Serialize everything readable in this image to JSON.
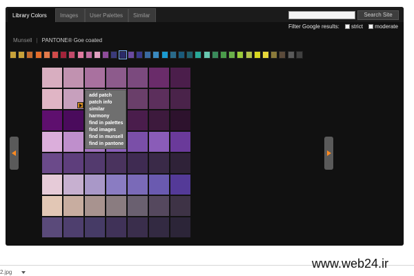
{
  "tabs": [
    {
      "label": "Library Colors",
      "active": true
    },
    {
      "label": "Images",
      "active": false
    },
    {
      "label": "User Palettes",
      "active": false
    },
    {
      "label": "Similar",
      "active": false
    }
  ],
  "search": {
    "placeholder": "",
    "button_label": "Search Site"
  },
  "filter": {
    "label": "Filter Google results:",
    "options": [
      {
        "label": "strict",
        "checked": false
      },
      {
        "label": "moderate",
        "checked": false
      }
    ]
  },
  "library": {
    "munsell": "Munsell",
    "separator": "|",
    "current": "PANTONE® Goe coated"
  },
  "hue_strip": {
    "selected_index": 13,
    "colors": [
      "#c8a23a",
      "#c8a23a",
      "#c46a2e",
      "#e36d2a",
      "#e27a4a",
      "#d04b4a",
      "#a3243a",
      "#c24a6a",
      "#e07aa0",
      "#c06ca0",
      "#e0a0c0",
      "#8e4c9a",
      "#3b3b7a",
      "#2b2b6a",
      "#6a4aa0",
      "#3a3a8a",
      "#3a6aa0",
      "#3a8ac0",
      "#1a9ad0",
      "#2a6a8a",
      "#1a5a7a",
      "#1f5f6a",
      "#28a898",
      "#68c8b0",
      "#3a8a5a",
      "#4a9a4a",
      "#6ab04a",
      "#9acb3a",
      "#b0c04a",
      "#d8d820",
      "#e8d83a",
      "#8a7a3a",
      "#5a4a3a",
      "#5a5a5a",
      "#404040"
    ]
  },
  "swatch_grid": {
    "rows": [
      [
        "#d8aec0",
        "#c192b0",
        "#a9719f",
        "#8d5b8c",
        "#7b4a7e",
        "#6a2c6a",
        "#4b1e4b"
      ],
      [
        "#e0b5c5",
        "#c7a0bd",
        "#aa7da5",
        "#8a5c88",
        "#6a3f6a",
        "#5c2f5c",
        "#4a234a"
      ],
      [
        "#5e0f6e",
        "#4a0b5c",
        "#7a3d8a",
        "#5c2a60",
        "#4a1d4c",
        "#3d1a3d",
        "#2d122d"
      ],
      [
        "#dbaedb",
        "#bf8fcc",
        "#a274c0",
        "#8a60b8",
        "#7a4fa8",
        "#8a5cb8",
        "#6a3a9a"
      ],
      [
        "#6b4a8a",
        "#5e3e7c",
        "#533a6e",
        "#4a335e",
        "#3f2b52",
        "#3a2a48",
        "#2f2238"
      ],
      [
        "#e6cbd8",
        "#c7b0d0",
        "#a998c8",
        "#8a7cc2",
        "#7a6ab8",
        "#6a5ab0",
        "#543a98"
      ],
      [
        "#e2c7b5",
        "#c8ada0",
        "#a8938f",
        "#8a7c80",
        "#6a6070",
        "#55485e",
        "#3e3346"
      ],
      [
        "#5a4a7a",
        "#4e3f6e",
        "#463b66",
        "#403258",
        "#3a2e4c",
        "#332a42",
        "#2c2538"
      ]
    ]
  },
  "context_menu": {
    "items": [
      "add patch",
      "patch info",
      "similar",
      "harmony",
      "find in palettes",
      "find images",
      "find in munsell",
      "find in pantone"
    ]
  },
  "footer": {
    "file_fragment": "2.jpg"
  },
  "watermark": "www.web24.ir",
  "colors": {
    "panel_bg": "#111111",
    "accent_arrow": "#ff8a1f",
    "marker": "#d28a20"
  }
}
